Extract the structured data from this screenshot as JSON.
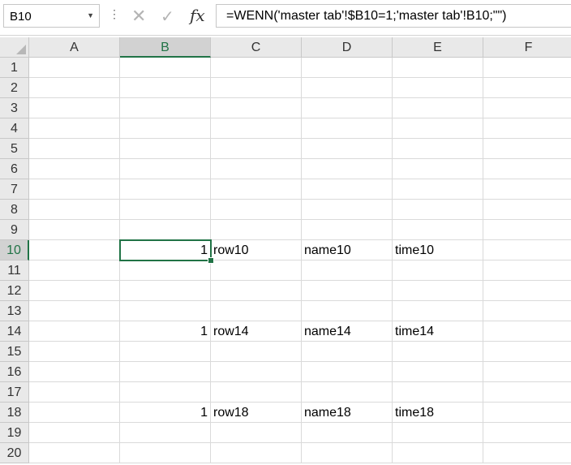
{
  "name_box": {
    "value": "B10"
  },
  "formula_bar": {
    "cancel_glyph": "✕",
    "enter_glyph": "✓",
    "fx_label": "fx",
    "formula": "=WENN('master tab'!$B10=1;'master tab'!B10;\"\")"
  },
  "columns": [
    "A",
    "B",
    "C",
    "D",
    "E",
    "F"
  ],
  "selected_column": "B",
  "rows": [
    "1",
    "2",
    "3",
    "4",
    "5",
    "6",
    "7",
    "8",
    "9",
    "10",
    "11",
    "12",
    "13",
    "14",
    "15",
    "16",
    "17",
    "18",
    "19",
    "20"
  ],
  "selected_row": "10",
  "cells": {
    "B10": "1",
    "C10": "row10",
    "D10": "name10",
    "E10": "time10",
    "B14": "1",
    "C14": "row14",
    "D14": "name14",
    "E14": "time14",
    "B18": "1",
    "C18": "row18",
    "D18": "name18",
    "E18": "time18"
  },
  "colors": {
    "selection": "#217346",
    "header_bg": "#e9e9e9",
    "gridline": "#dadada"
  }
}
